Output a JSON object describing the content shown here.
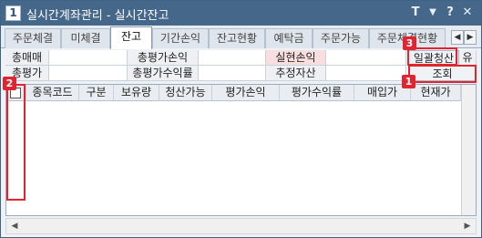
{
  "window": {
    "icon_text": "1",
    "title": "실시간계좌관리 - 실시간잔고",
    "controls": {
      "theme": "T",
      "pin": "▼",
      "help": "?",
      "close": "✕"
    }
  },
  "tabs": [
    {
      "label": "주문체결"
    },
    {
      "label": "미체결"
    },
    {
      "label": "잔고"
    },
    {
      "label": "기간손익"
    },
    {
      "label": "잔고현황"
    },
    {
      "label": "예탁금"
    },
    {
      "label": "주문가능"
    },
    {
      "label": "주문체결현황"
    }
  ],
  "active_tab": "잔고",
  "tab_nav": {
    "prev": "◀",
    "next": "▶"
  },
  "summary": {
    "row1": {
      "total_buy_label": "총매매",
      "total_eval_pnl_label": "총평가손익",
      "realized_pnl_label": "실현손익",
      "bulk_settle_label": "일괄청산",
      "extra_label": "유"
    },
    "row2": {
      "total_eval_label": "총평가",
      "total_eval_rate_label": "총평가수익률",
      "est_asset_label": "추정자산",
      "query_label": "조회"
    }
  },
  "grid": {
    "columns": [
      "종목코드",
      "구분",
      "보유량",
      "청산가능",
      "평가손익",
      "평가수익률",
      "매입가",
      "현재가"
    ]
  },
  "scroll": {
    "left": "◀",
    "right": "▶"
  },
  "callouts": [
    "1",
    "2",
    "3"
  ],
  "colors": {
    "title_bar": "#44678a",
    "highlight": "#e02531",
    "realized_label_bg": "#f8dede"
  }
}
